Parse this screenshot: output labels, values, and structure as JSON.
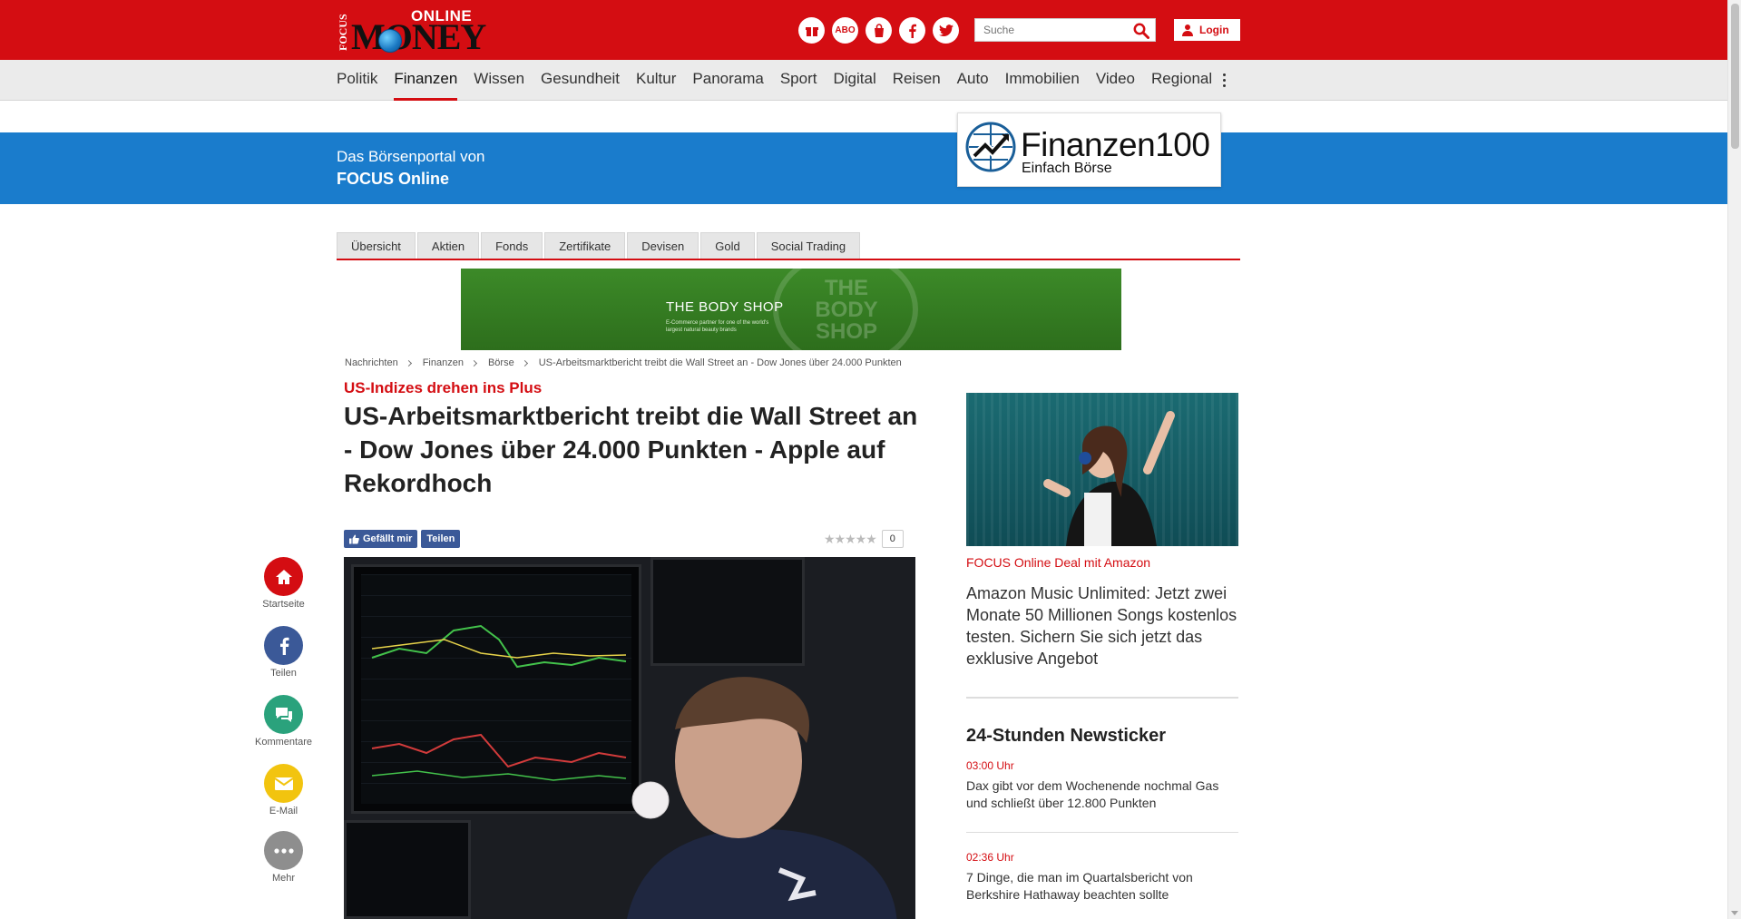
{
  "header": {
    "logo": {
      "focus": "FOCUS",
      "online": "ONLINE",
      "money": "MONEY"
    },
    "icons": [
      "gift-icon",
      "abo-icon",
      "bag-icon",
      "facebook-icon",
      "twitter-icon"
    ],
    "abo_label": "ABO",
    "search_placeholder": "Suche",
    "login_label": "Login"
  },
  "nav": {
    "items": [
      "Politik",
      "Finanzen",
      "Wissen",
      "Gesundheit",
      "Kultur",
      "Panorama",
      "Sport",
      "Digital",
      "Reisen",
      "Auto",
      "Immobilien",
      "Video",
      "Regional"
    ],
    "active": "Finanzen"
  },
  "banner": {
    "line1": "Das Börsenportal von",
    "line2": "FOCUS Online",
    "partner_title": "Finanzen100",
    "partner_sub": "Einfach Börse"
  },
  "subtabs": [
    "Übersicht",
    "Aktien",
    "Fonds",
    "Zertifikate",
    "Devisen",
    "Gold",
    "Social Trading"
  ],
  "ad": {
    "brand": "THE BODY SHOP",
    "desc": "E-Commerce partner for one of the world's largest natural beauty brands",
    "watermark": "THE BODY SHOP"
  },
  "breadcrumb": [
    "Nachrichten",
    "Finanzen",
    "Börse",
    "US-Arbeitsmarktbericht treibt die Wall Street an - Dow Jones über 24.000 Punkten"
  ],
  "article": {
    "kicker": "US-Indizes drehen ins Plus",
    "headline": "US-Arbeitsmarktbericht treibt die Wall Street an - Dow Jones über 24.000 Punkten - Apple auf Rekordhoch",
    "like_label": "Gefällt mir",
    "share_label": "Teilen",
    "rating_count": "0"
  },
  "rail": [
    {
      "label": "Startseite",
      "icon": "home-icon",
      "color": "#d40d12"
    },
    {
      "label": "Teilen",
      "icon": "facebook-icon",
      "color": "#3b5998"
    },
    {
      "label": "Kommentare",
      "icon": "comments-icon",
      "color": "#2aa27c"
    },
    {
      "label": "E-Mail",
      "icon": "mail-icon",
      "color": "#f2c40f"
    },
    {
      "label": "Mehr",
      "icon": "more-icon",
      "color": "#8e8e8e"
    }
  ],
  "sidebar": {
    "promo_kicker": "FOCUS Online Deal mit Amazon",
    "promo_title": "Amazon Music Unlimited: Jetzt zwei Monate 50 Millionen Songs kostenlos testen. Sichern Sie sich jetzt das exklusive Angebot",
    "ticker_title": "24-Stunden Newsticker",
    "ticker": [
      {
        "time": "03:00 Uhr",
        "text": "Dax gibt vor dem Wochenende nochmal Gas und schließt über 12.800 Punkten"
      },
      {
        "time": "02:36 Uhr",
        "text": "7 Dinge, die man im Quartalsbericht von Berkshire Hathaway beachten sollte"
      }
    ]
  },
  "colors": {
    "brand_red": "#d40d12",
    "banner_blue": "#1a7ccc"
  }
}
